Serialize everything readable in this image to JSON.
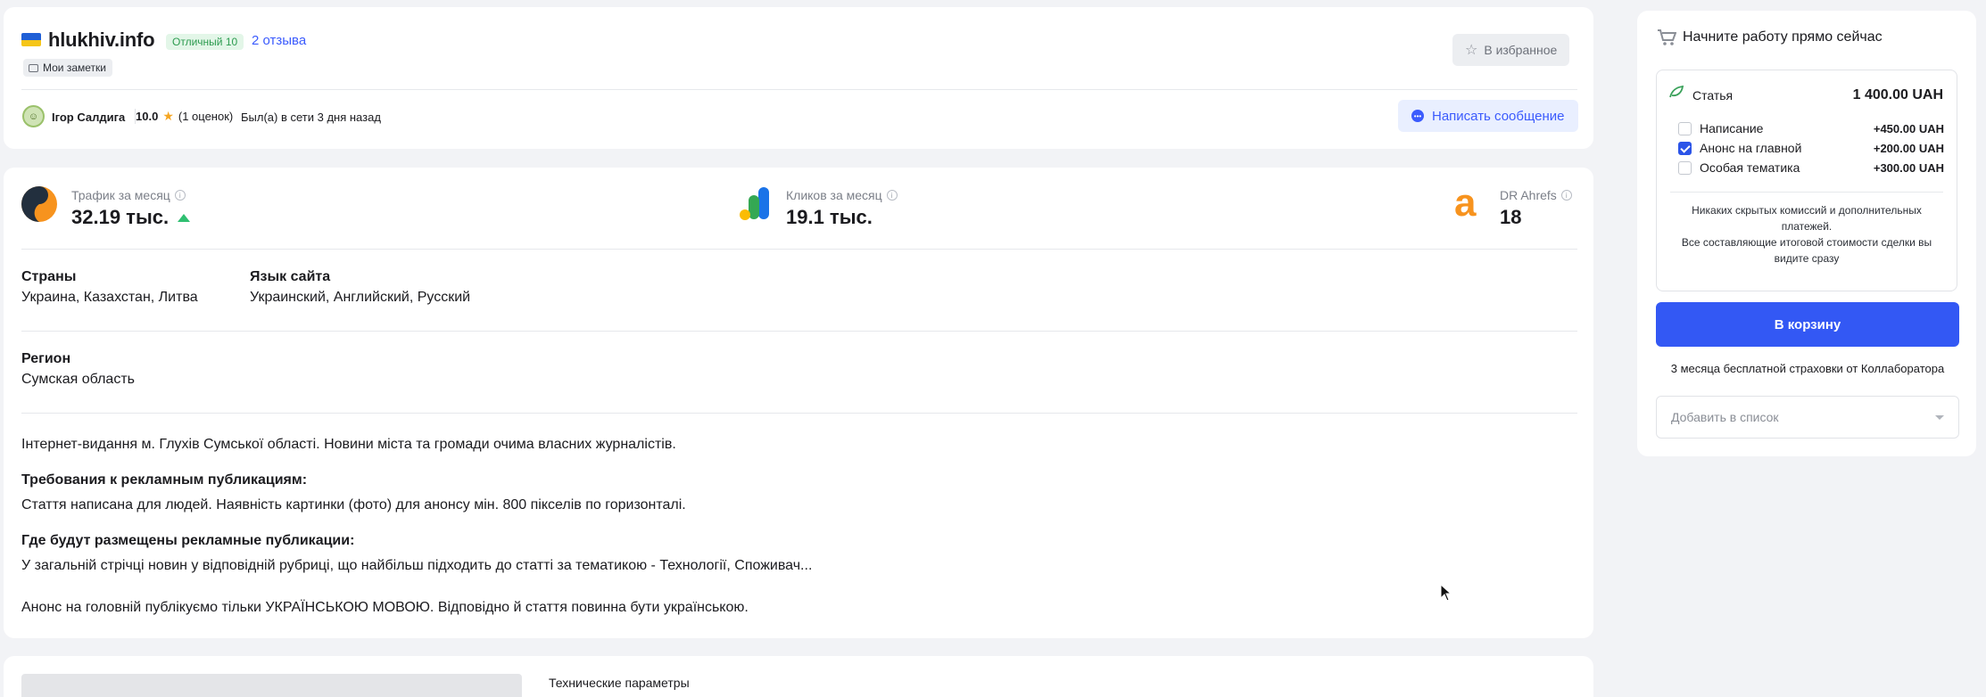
{
  "site": {
    "name": "hlukhiv.info",
    "rating_badge": "Отличный 10",
    "reviews_link": "2 отзыва",
    "notes_chip": "Мои заметки",
    "favorite_button": "В избранное"
  },
  "owner": {
    "name": "Ігор Салдига",
    "rating": "10.0",
    "ratings_count": "(1 оценок)",
    "last_seen": "Был(а) в сети 3 дня назад",
    "message_button": "Написать сообщение"
  },
  "metrics": [
    {
      "label": "Трафик за месяц",
      "value": "32.19 тыс.",
      "trend": "up"
    },
    {
      "label": "Кликов за месяц",
      "value": "19.1 тыс."
    },
    {
      "label": "DR Ahrefs",
      "value": "18"
    }
  ],
  "details": {
    "countries_label": "Страны",
    "countries_value": "Украина, Казахстан, Литва",
    "language_label": "Язык сайта",
    "language_value": "Украинский, Английский, Русский",
    "region_label": "Регион",
    "region_value": "Сумская область"
  },
  "description": {
    "intro": "Інтернет-видання м. Глухів Сумської області. Новини міста та громади очима власних журналістів.",
    "req_label": "Требования к рекламным публикациям:",
    "req_text": "Стаття написана для людей. Наявність картинки (фото) для анонсу мін. 800 пікселів по горизонталі.",
    "place_label": "Где будут размещены рекламные публикации:",
    "place_text": "У загальній стрічці новин у відповідній рубриці, що найбільш підходить до статті за тематикою - Технології, Споживач...",
    "note": "Анонс на головній публікуємо тільки УКРАЇНСЬКОЮ МОВОЮ. Відповідно й стаття повинна бути українською."
  },
  "tech": {
    "title": "Технические параметры"
  },
  "order": {
    "header": "Начните работу прямо сейчас",
    "product": "Статья",
    "product_price": "1 400.00 UAH",
    "options": [
      {
        "label": "Написание",
        "price": "+450.00 UAH",
        "checked": false
      },
      {
        "label": "Анонс на главной",
        "price": "+200.00 UAH",
        "checked": true
      },
      {
        "label": "Особая тематика",
        "price": "+300.00 UAH",
        "checked": false
      }
    ],
    "note_line1": "Никаких скрытых комиссий и дополнительных",
    "note_line2": "платежей.",
    "note_line3": "Все составляющие итоговой стоимости сделки вы",
    "note_line4": "видите сразу",
    "cart_button": "В корзину",
    "insurance": "3 месяца бесплатной страховки от Коллаборатора",
    "list_placeholder": "Добавить в список"
  },
  "colors": {
    "accent": "#3b5bfd",
    "cart": "#3358f4",
    "star": "#f5a623"
  }
}
